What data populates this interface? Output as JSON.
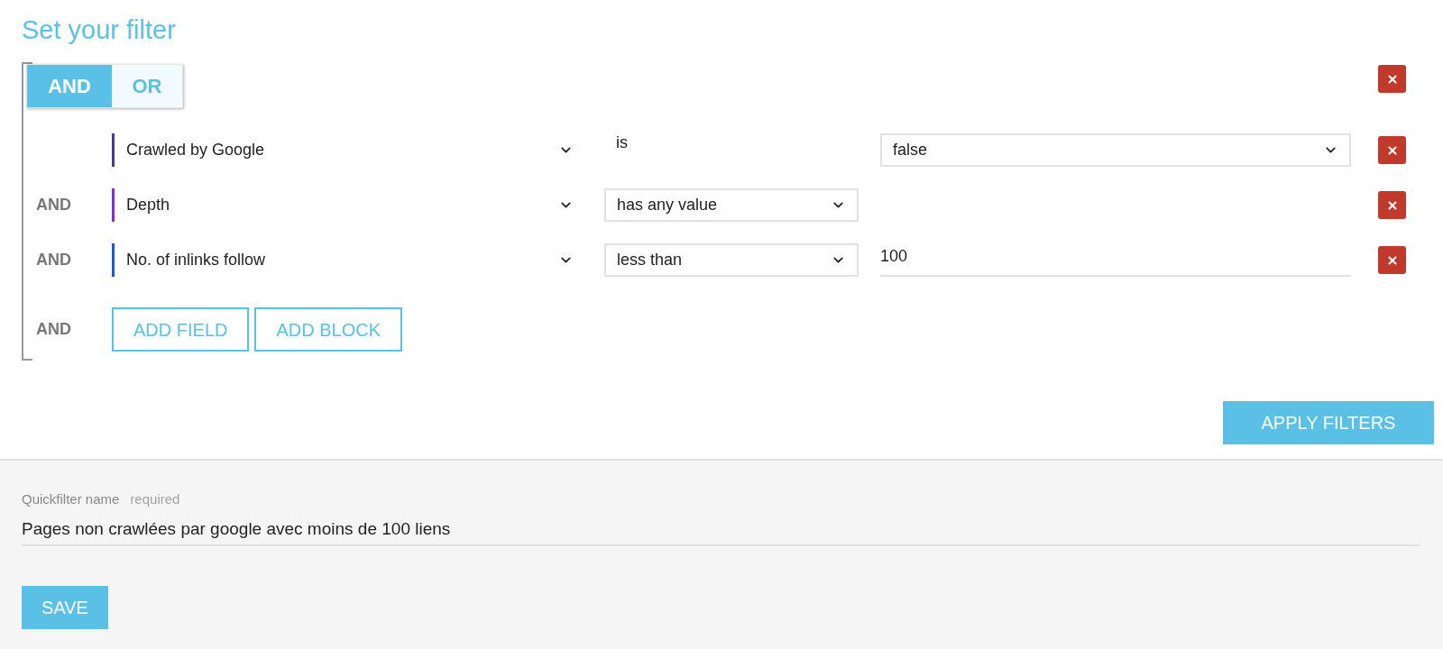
{
  "title": "Set your filter",
  "logic_toggle": [
    {
      "label": "AND",
      "selected": true
    },
    {
      "label": "OR",
      "selected": false
    }
  ],
  "conditions": [
    {
      "field": "Crawled by Google",
      "color": "#3f3d99",
      "operator": {
        "kind": "text",
        "label": "is"
      },
      "value": {
        "kind": "select",
        "text": "false"
      }
    },
    {
      "connector": "AND",
      "field": "Depth",
      "color": "#8a2bd0",
      "operator": {
        "kind": "select",
        "label": "has any value"
      }
    },
    {
      "connector": "AND",
      "field": "No. of inlinks follow",
      "color": "#1a56d6",
      "operator": {
        "kind": "select",
        "label": "less than"
      },
      "value": {
        "kind": "input",
        "text": "100"
      }
    }
  ],
  "add_row": {
    "connector": "AND",
    "buttons": [
      "ADD FIELD",
      "ADD BLOCK"
    ]
  },
  "apply_button": "APPLY FILTERS",
  "quickfilter": {
    "label": "Quickfilter name",
    "hint": "required",
    "value": "Pages non crawlées par google avec moins de 100 liens"
  },
  "save_button": "SAVE"
}
